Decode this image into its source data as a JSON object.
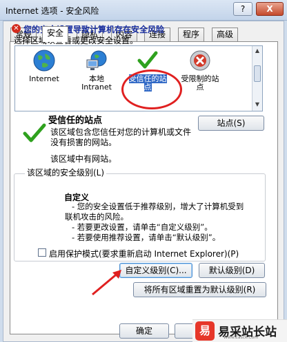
{
  "window": {
    "title": "Internet 选项 - 安全风险",
    "help_label": "?",
    "close_label": "X"
  },
  "tabs": [
    {
      "label": "常规"
    },
    {
      "label": "安全"
    },
    {
      "label": "隐私"
    },
    {
      "label": "内容"
    },
    {
      "label": "连接"
    },
    {
      "label": "程序"
    },
    {
      "label": "高级"
    }
  ],
  "security": {
    "warning_text": "您的安全设置导致计算机存在安全风险",
    "choose_zone_label": "选择区域以查看或更改安全设置。",
    "zones": [
      {
        "label": "Internet",
        "icon": "globe-icon"
      },
      {
        "label": "本地\nIntranet",
        "icon": "intranet-icon"
      },
      {
        "label": "受信任的站\n点",
        "icon": "checkmark-icon"
      },
      {
        "label": "受限制的站\n点",
        "icon": "restricted-icon"
      }
    ],
    "zone_title": "受信任的站点",
    "zone_desc": "该区域包含您信任对您的计算机或文件没有损害的网站。",
    "sites_button": "站点(S)",
    "no_sites": "该区域中有网站。",
    "level_group_label": "该区域的安全级别(L)",
    "custom_title": "自定义",
    "custom_lines": [
      "- 您的安全设置低于推荐级别，增大了计算机受到",
      "联机攻击的风险。",
      "- 若要更改设置，请单击“自定义级别”。",
      "- 若要使用推荐设置，请单击“默认级别”。"
    ],
    "protected_mode_label": "启用保护模式(要求重新启动 Internet Explorer)(P)",
    "custom_level_button": "自定义级别(C)...",
    "default_level_button": "默认级别(D)",
    "reset_all_button": "将所有区域重置为默认级别(R)"
  },
  "footer": {
    "ok_button": "确定",
    "cancel_button": "取"
  },
  "watermark": {
    "text": "易采站长站",
    "url": "Www.Easck.Com",
    "icon_glyph": "易"
  },
  "colors": {
    "warning_text": "#1a2fa0",
    "selection": "#3169c6",
    "annotation_red": "#e02020",
    "check_green": "#2fa11e"
  }
}
